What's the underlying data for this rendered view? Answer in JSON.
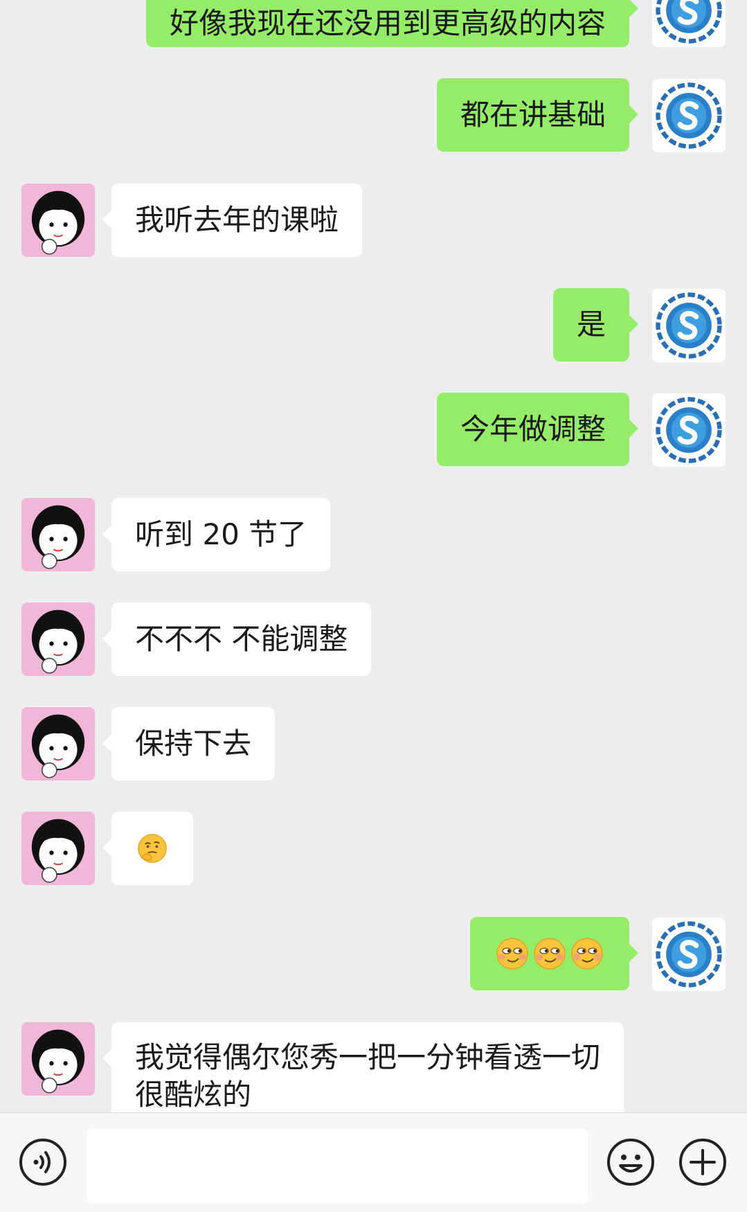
{
  "chat": {
    "messages": [
      {
        "sender": "me",
        "text": "好像我现在还没用到更高级的内容"
      },
      {
        "sender": "me",
        "text": "都在讲基础"
      },
      {
        "sender": "her",
        "text": "我听去年的课啦"
      },
      {
        "sender": "me",
        "text": "是"
      },
      {
        "sender": "me",
        "text": "今年做调整"
      },
      {
        "sender": "her",
        "text": "听到 20 节了"
      },
      {
        "sender": "her",
        "text": "不不不 不能调整"
      },
      {
        "sender": "her",
        "text": "保持下去"
      },
      {
        "sender": "her",
        "emoji": [
          "thinking-face-emoji"
        ]
      },
      {
        "sender": "me",
        "emoji": [
          "smirk-face-emoji",
          "smirk-face-emoji",
          "smirk-face-emoji"
        ]
      },
      {
        "sender": "her",
        "text": "我觉得偶尔您秀一把一分钟看透一切 很酷炫的"
      }
    ]
  },
  "input_bar": {
    "voice_icon": "voice-icon",
    "emoji_icon": "emoji-icon",
    "plus_icon": "plus-icon",
    "text_value": ""
  },
  "colors": {
    "background": "#ededed",
    "my_bubble": "#95ec69",
    "their_bubble": "#ffffff",
    "their_avatar_bg": "#f2b6d8"
  }
}
